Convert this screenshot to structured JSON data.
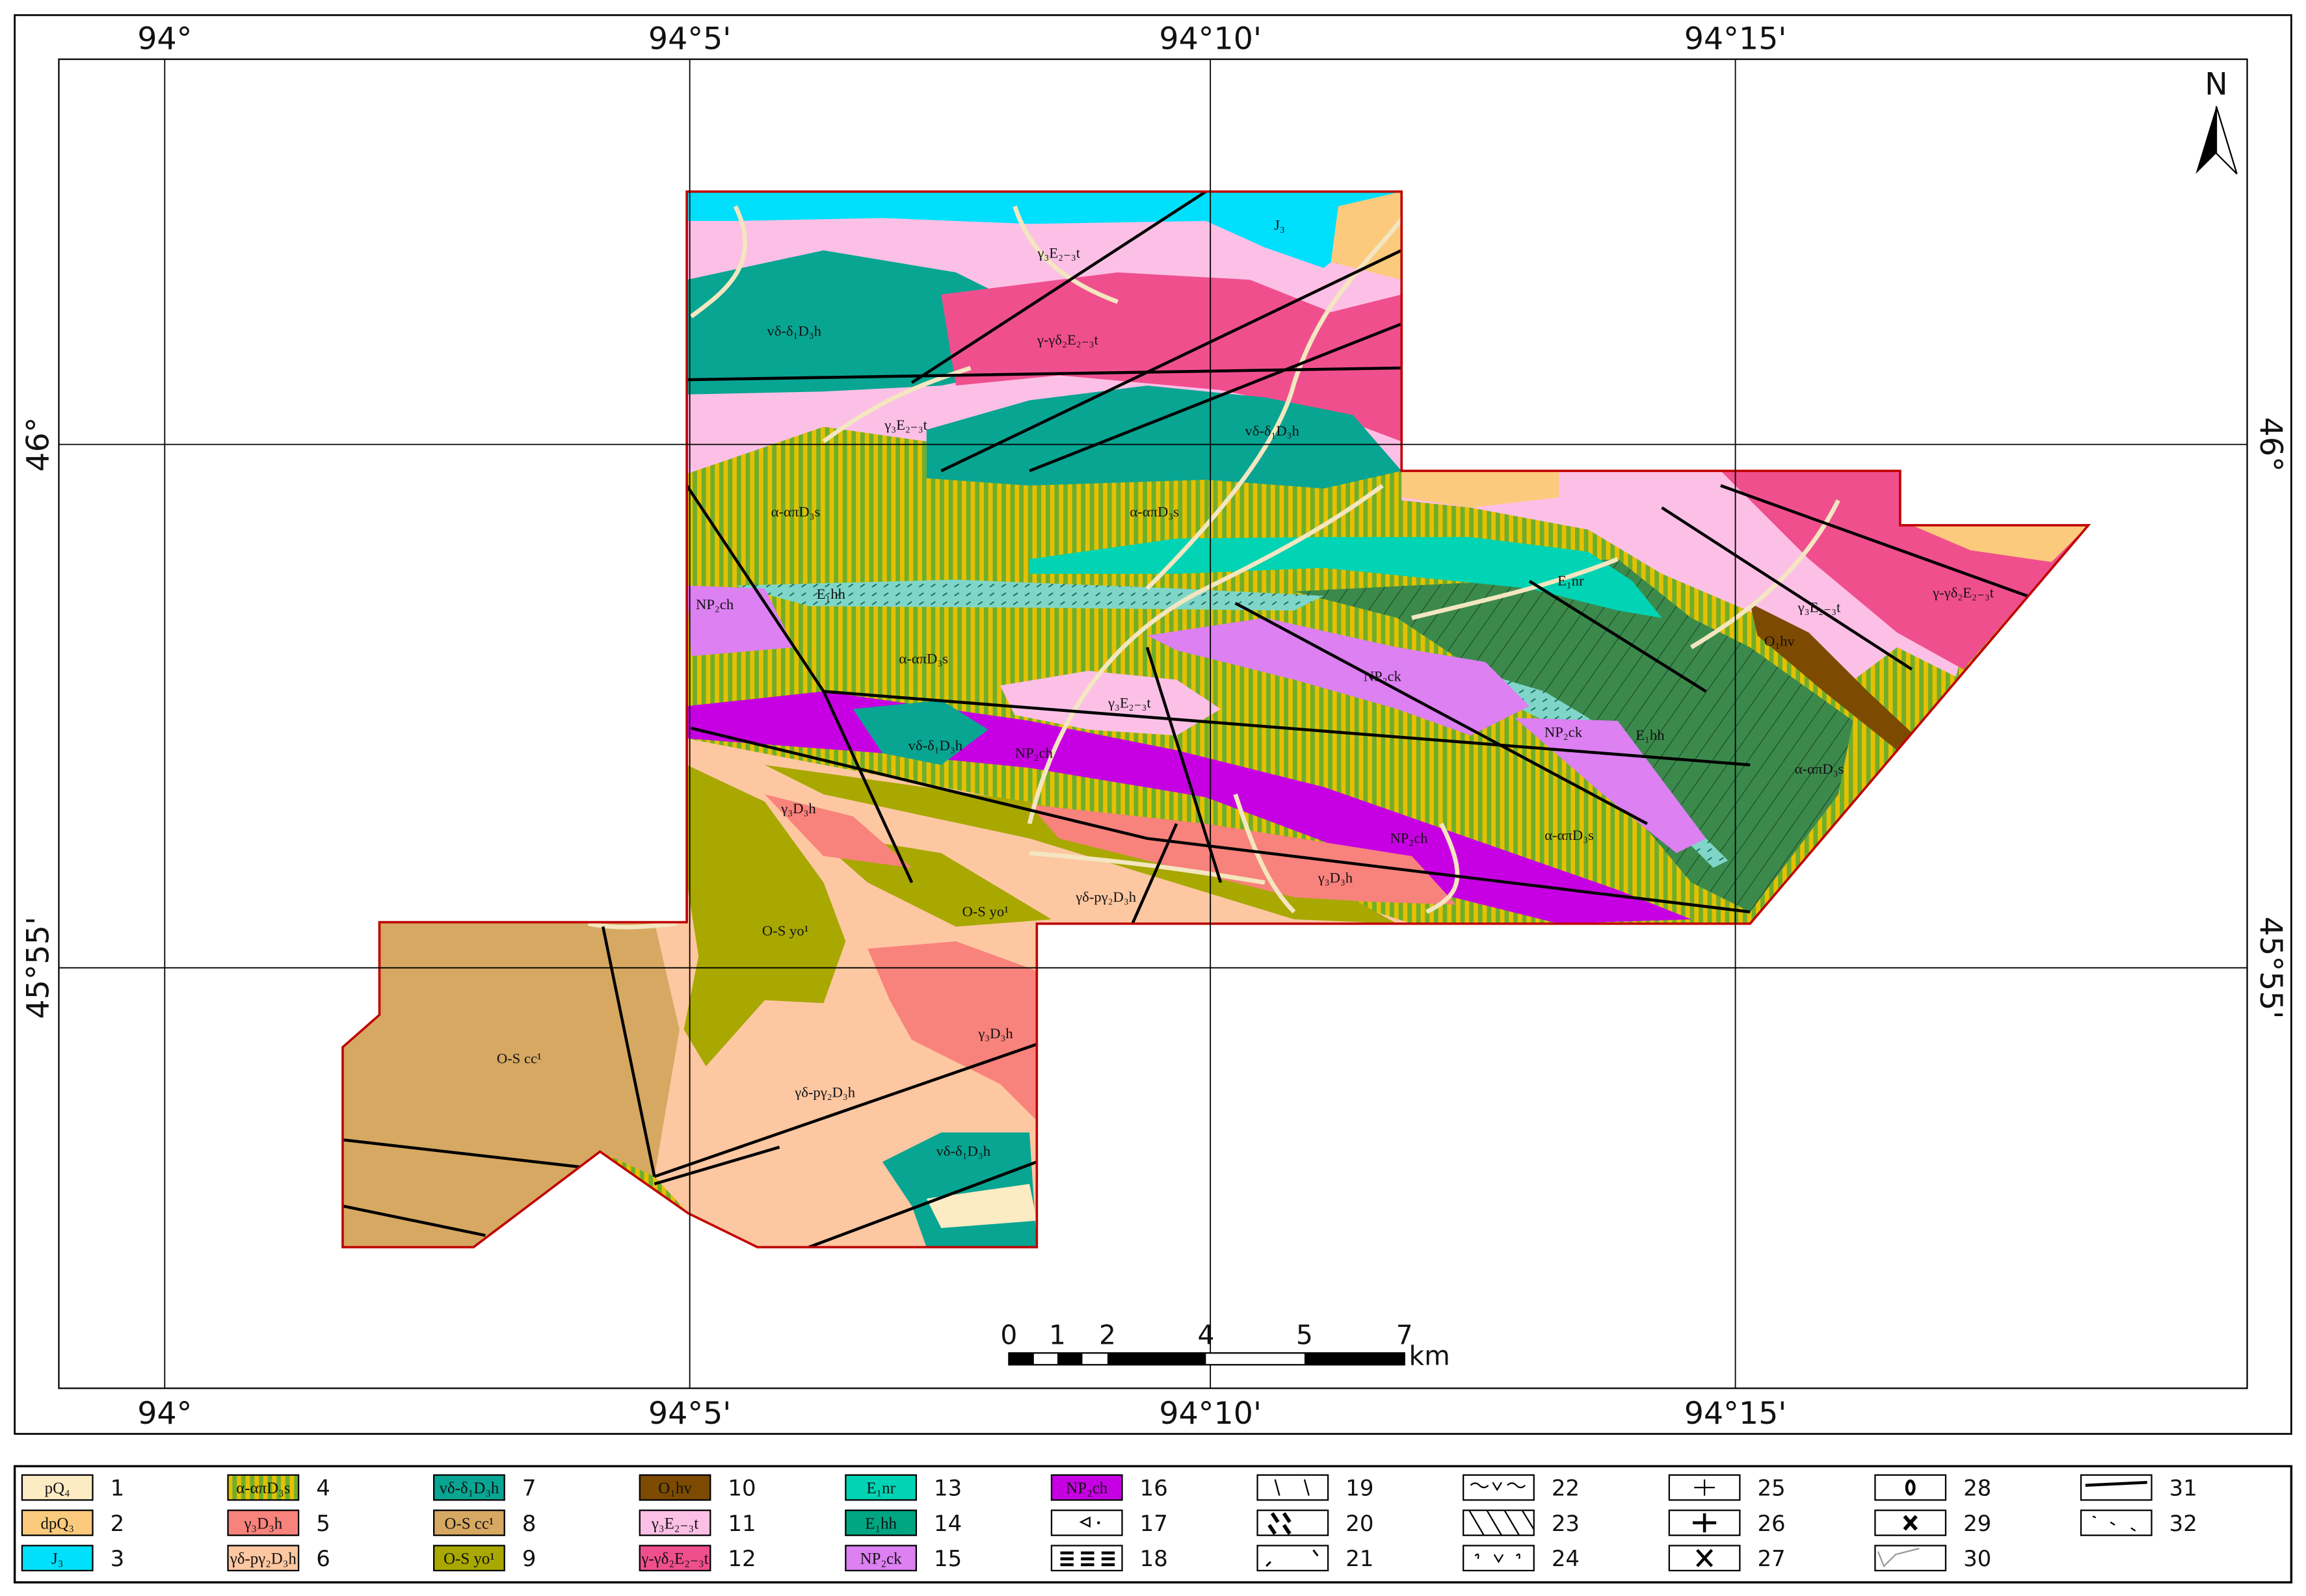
{
  "axes": {
    "longitudes": [
      "94°",
      "94°5'",
      "94°10'",
      "94°15'"
    ],
    "latitudes": [
      "46°",
      "45°55'"
    ]
  },
  "north_arrow": {
    "label": "N"
  },
  "scale_bar": {
    "ticks": [
      "0",
      "1",
      "2",
      "4",
      "5",
      "7"
    ],
    "unit": "km"
  },
  "map": {
    "labels": [
      "γ₃E₂₋₃t",
      "vδ-δ₁D₃h",
      "γ-γδ₂E₂₋₃t",
      "γ₃E₂₋₃t",
      "vδ-δ₁D₃h",
      "J₃",
      "α-απD₃s",
      "α-απD₃s",
      "E₁nr",
      "NP₂ch",
      "E₁hh",
      "α-απD₃s",
      "NP₂ck",
      "γ₃E₂₋₃t",
      "vδ-δ₁D₃h",
      "NP₂ch",
      "NP₂ck",
      "E₁hh",
      "γ₃E₂₋₃t",
      "O₁hv",
      "γ-γδ₂E₂₋₃t",
      "α-απD₃s",
      "α-απD₃s",
      "NP₂ch",
      "γ₃D₃h",
      "γ₃D₃h",
      "γδ-pγ₂D₃h",
      "O-S yo¹",
      "O-S yo¹",
      "γ₃D₃h",
      "γδ-pγ₂D₃h",
      "O-S cc¹",
      "vδ-δ₁D₃h"
    ]
  },
  "colors": {
    "pQ4": "#fdebc4",
    "dpQ3": "#fcca7c",
    "J3": "#00e0fc",
    "stripe_green": "#6fae2c",
    "stripe_yellow": "#e6c000",
    "g3D3h": "#f8827c",
    "gdpg2": "#fdc7a2",
    "vd": "#08a592",
    "OScc": "#d6a862",
    "OSyo": "#a8a800",
    "O1hv": "#7c4a00",
    "g3E": "#fcc0e6",
    "ggd2": "#f04f8e",
    "E1nr": "#00d4b4",
    "E1hh": "#00a682",
    "NP2ck": "#dc80f2",
    "NP2ch": "#c600e2",
    "dark_green": "#3b8a4c",
    "boundary": "#c00000"
  },
  "legend": [
    {
      "num": "1",
      "label": "pQ₄",
      "color": "#fdebc4"
    },
    {
      "num": "2",
      "label": "dpQ₃",
      "color": "#fcca7c"
    },
    {
      "num": "3",
      "label": "J₃",
      "color": "#00e0fc"
    },
    {
      "num": "4",
      "label": "α-απD₃s",
      "color": "stripe"
    },
    {
      "num": "5",
      "label": "γ₃D₃h",
      "color": "#f8827c"
    },
    {
      "num": "6",
      "label": "γδ-pγ₂D₃h",
      "color": "#fdc7a2"
    },
    {
      "num": "7",
      "label": "vδ-δ₁D₃h",
      "color": "#08a592"
    },
    {
      "num": "8",
      "label": "O-S cc¹",
      "color": "#d6a862"
    },
    {
      "num": "9",
      "label": "O-S yo¹",
      "color": "#a8a800"
    },
    {
      "num": "10",
      "label": "O₁hv",
      "color": "#7c4a00"
    },
    {
      "num": "11",
      "label": "γ₃E₂₋₃t",
      "color": "#fcc0e6"
    },
    {
      "num": "12",
      "label": "γ-γδ₂E₂₋₃t",
      "color": "#f04f8e"
    },
    {
      "num": "13",
      "label": "E₁nr",
      "color": "#00d4b4"
    },
    {
      "num": "14",
      "label": "E₁hh",
      "color": "#00a682"
    },
    {
      "num": "15",
      "label": "NP₂ck",
      "color": "#dc80f2"
    },
    {
      "num": "16",
      "label": "NP₂ch",
      "color": "#c600e2"
    },
    {
      "num": "17",
      "icon": "triangle-dot"
    },
    {
      "num": "18",
      "icon": "dashes"
    },
    {
      "num": "19",
      "icon": "thin-ticks"
    },
    {
      "num": "20",
      "icon": "bold-ticks"
    },
    {
      "num": "21",
      "icon": "hooks"
    },
    {
      "num": "22",
      "icon": "tilde-v"
    },
    {
      "num": "23",
      "icon": "hatch"
    },
    {
      "num": "24",
      "icon": "hook-v"
    },
    {
      "num": "25",
      "icon": "plus-thin"
    },
    {
      "num": "26",
      "icon": "plus-bold"
    },
    {
      "num": "27",
      "icon": "cross"
    },
    {
      "num": "28",
      "icon": "zero"
    },
    {
      "num": "29",
      "icon": "cross-bold"
    },
    {
      "num": "30",
      "icon": "river-line"
    },
    {
      "num": "31",
      "icon": "fault-line"
    },
    {
      "num": "32",
      "icon": "dash-diag"
    }
  ]
}
